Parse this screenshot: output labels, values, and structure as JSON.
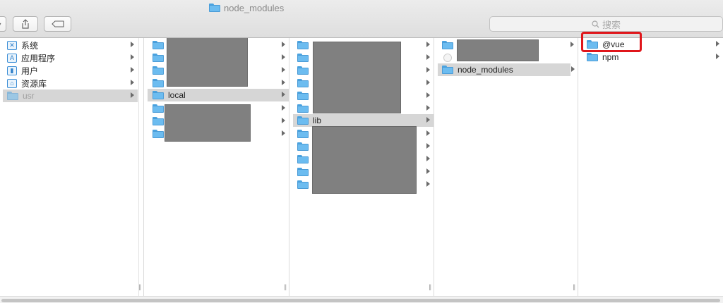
{
  "window": {
    "title": "node_modules"
  },
  "search": {
    "placeholder": "搜索"
  },
  "columns": {
    "sidebar": {
      "items": [
        {
          "label": "系统",
          "icon": "system-icon"
        },
        {
          "label": "应用程序",
          "icon": "applications-icon"
        },
        {
          "label": "用户",
          "icon": "users-icon"
        },
        {
          "label": "资源库",
          "icon": "library-icon"
        },
        {
          "label": "usr",
          "icon": "folder-icon",
          "selected": true
        }
      ]
    },
    "col2": {
      "selected_label": "local"
    },
    "col3": {
      "selected_label": "lib"
    },
    "col4": {
      "selected_label": "node_modules"
    },
    "col5": {
      "items": [
        {
          "label": "@vue"
        },
        {
          "label": "npm"
        }
      ]
    }
  },
  "colors": {
    "folder": "#6cbcf0",
    "selection": "#d6d6d6",
    "highlight": "#e0161b",
    "redaction": "#808080"
  }
}
